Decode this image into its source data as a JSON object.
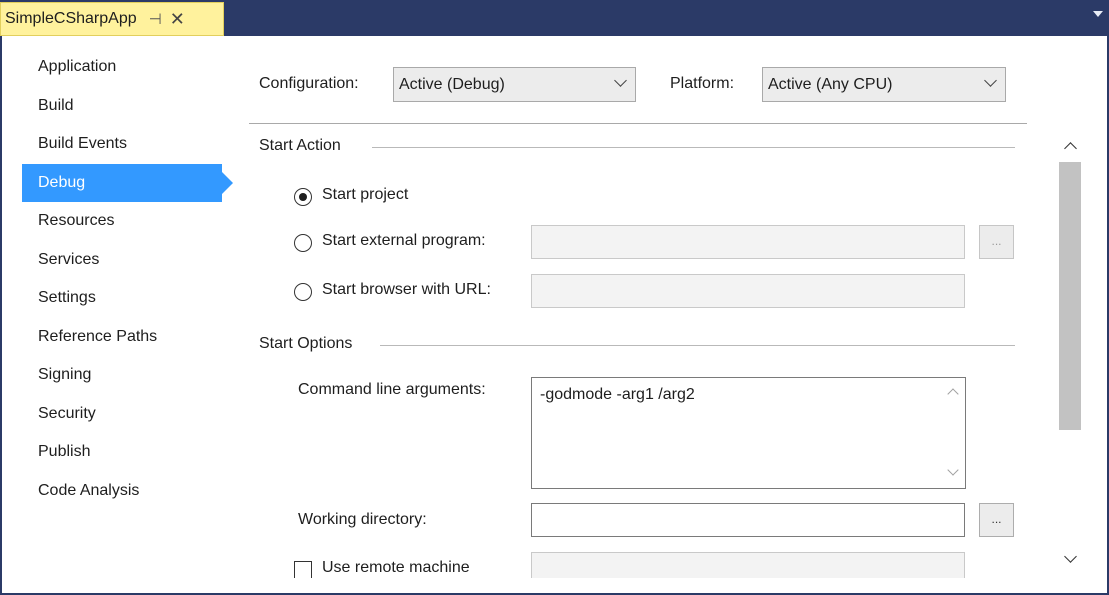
{
  "document_tab": {
    "title": "SimpleCSharpApp",
    "pin_glyph": "⊣",
    "close_glyph": "✕"
  },
  "sidebar": {
    "active": "Debug",
    "items": [
      {
        "label": "Application"
      },
      {
        "label": "Build"
      },
      {
        "label": "Build Events"
      },
      {
        "label": "Debug"
      },
      {
        "label": "Resources"
      },
      {
        "label": "Services"
      },
      {
        "label": "Settings"
      },
      {
        "label": "Reference Paths"
      },
      {
        "label": "Signing"
      },
      {
        "label": "Security"
      },
      {
        "label": "Publish"
      },
      {
        "label": "Code Analysis"
      }
    ]
  },
  "config": {
    "configuration_label": "Configuration:",
    "configuration_value": "Active (Debug)",
    "platform_label": "Platform:",
    "platform_value": "Active (Any CPU)"
  },
  "start_action": {
    "title": "Start Action",
    "selected": "Start project",
    "options": [
      {
        "label": "Start project"
      },
      {
        "label": "Start external program:"
      },
      {
        "label": "Start browser with URL:"
      }
    ],
    "browse_label": "..."
  },
  "start_options": {
    "title": "Start Options",
    "command_line_label": "Command line arguments:",
    "command_line_value": "-godmode -arg1 /arg2",
    "working_directory_label": "Working directory:",
    "working_directory_value": "",
    "browse_label": "...",
    "remote_machine_label": "Use remote machine",
    "remote_machine_checked": false
  },
  "colors": {
    "tab_strip": "#2b3a67",
    "active_tab": "#fff29d",
    "selection": "#3399ff"
  }
}
